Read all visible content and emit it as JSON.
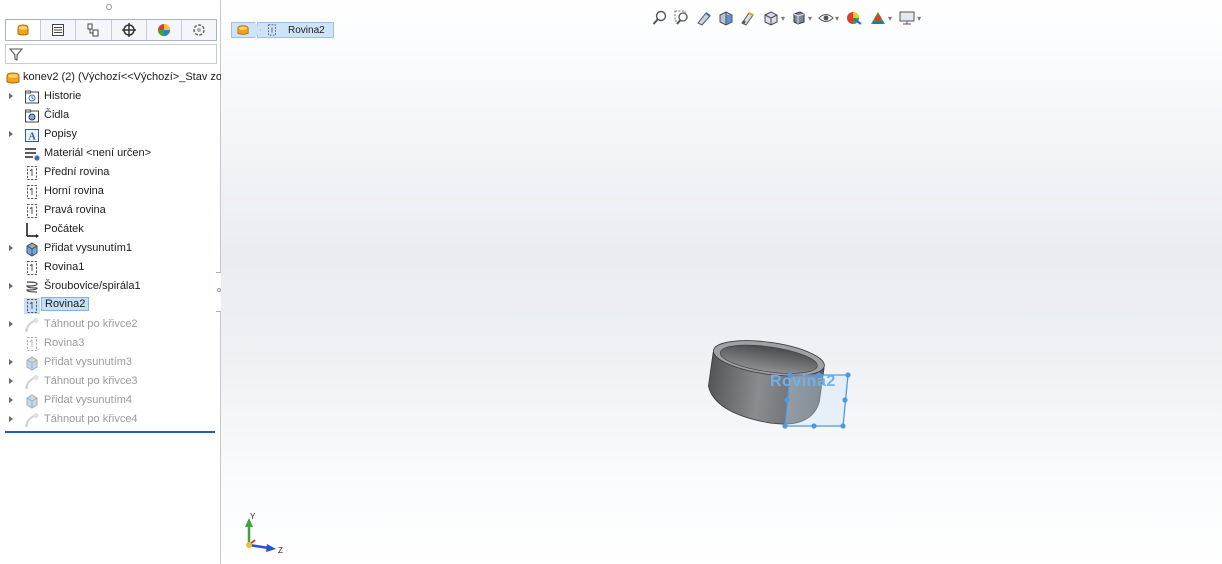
{
  "feature_tree": {
    "root_label": "konev2 (2)  (Výchozí<<Výchozí>_Stav zob",
    "items": [
      {
        "label": "Historie",
        "icon": "history-folder-icon",
        "expandable": true,
        "state": "normal"
      },
      {
        "label": "Čidla",
        "icon": "sensors-icon",
        "expandable": false,
        "state": "normal"
      },
      {
        "label": "Popisy",
        "icon": "annotations-icon",
        "expandable": true,
        "state": "normal"
      },
      {
        "label": "Materiál <není určen>",
        "icon": "material-icon",
        "expandable": false,
        "state": "normal"
      },
      {
        "label": "Přední rovina",
        "icon": "plane-icon",
        "expandable": false,
        "state": "normal"
      },
      {
        "label": "Horní rovina",
        "icon": "plane-icon",
        "expandable": false,
        "state": "normal"
      },
      {
        "label": "Pravá rovina",
        "icon": "plane-icon",
        "expandable": false,
        "state": "normal"
      },
      {
        "label": "Počátek",
        "icon": "origin-icon",
        "expandable": false,
        "state": "normal"
      },
      {
        "label": "Přidat vysunutím1",
        "icon": "extrude-icon",
        "expandable": true,
        "state": "normal"
      },
      {
        "label": "Rovina1",
        "icon": "plane-icon",
        "expandable": false,
        "state": "normal"
      },
      {
        "label": "Šroubovice/spirála1",
        "icon": "helix-icon",
        "expandable": true,
        "state": "normal"
      },
      {
        "label": "Rovina2",
        "icon": "plane-icon",
        "expandable": false,
        "state": "selected"
      },
      {
        "label": "Táhnout po křivce2",
        "icon": "sweep-icon",
        "expandable": true,
        "state": "suppressed"
      },
      {
        "label": "Rovina3",
        "icon": "plane-icon",
        "expandable": false,
        "state": "suppressed"
      },
      {
        "label": "Přidat vysunutím3",
        "icon": "extrude-icon",
        "expandable": true,
        "state": "suppressed"
      },
      {
        "label": "Táhnout po křivce3",
        "icon": "sweep-icon",
        "expandable": true,
        "state": "suppressed"
      },
      {
        "label": "Přidat vysunutím4",
        "icon": "extrude-icon",
        "expandable": true,
        "state": "suppressed"
      },
      {
        "label": "Táhnout po křivce4",
        "icon": "sweep-icon",
        "expandable": true,
        "state": "suppressed"
      }
    ]
  },
  "panel_tabs": [
    "feature-manager-icon",
    "property-manager-icon",
    "configuration-manager-icon",
    "dimxpert-icon",
    "display-manager-icon",
    "custom-tab-icon"
  ],
  "breadcrumb": {
    "item_label": "Rovina2"
  },
  "viewport": {
    "plane_label": "Rovina2",
    "triad": {
      "y_label": "Y",
      "z_label": "Z"
    }
  },
  "colors": {
    "selection": "#c7dff7",
    "rollback_bar": "#1f5fb8",
    "plane_preview": "#4a9be6",
    "model_gray": "#7d7e82"
  }
}
